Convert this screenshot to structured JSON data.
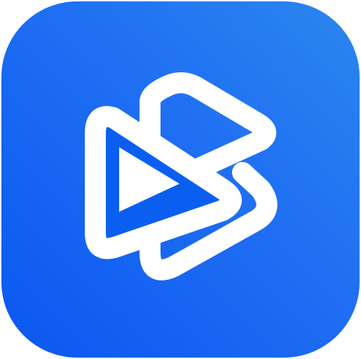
{
  "icon": {
    "name": "play-logo-app-icon",
    "background_gradient": [
      "#0a57f0",
      "#1f6ef3",
      "#2b86ee"
    ],
    "stroke_color": "#ffffff",
    "fill_color": "#0b5ff0"
  }
}
